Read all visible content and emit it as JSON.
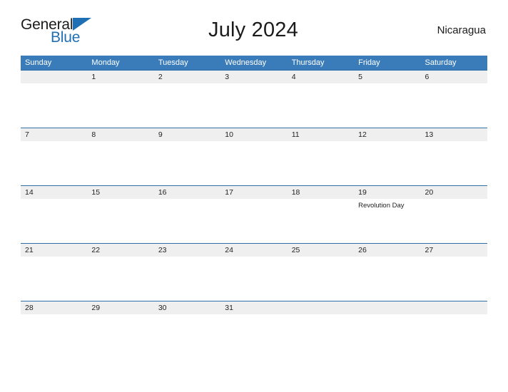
{
  "brand": {
    "name_part1": "General",
    "name_part2": "Blue",
    "flag_icon": "blue-triangle-flag-icon",
    "colors": {
      "general_text": "#1b1b1b",
      "blue_text": "#1f6fb5",
      "flag": "#1f6fb5"
    }
  },
  "header": {
    "title": "July 2024",
    "country": "Nicaragua"
  },
  "colors": {
    "header_bar": "#3a7cb9",
    "row_border": "#2f6fa8",
    "date_band": "#efefef",
    "page_background": "#ffffff",
    "text": "#222222"
  },
  "calendar": {
    "month": "July",
    "year": "2024",
    "weekday_headers": [
      "Sunday",
      "Monday",
      "Tuesday",
      "Wednesday",
      "Thursday",
      "Friday",
      "Saturday"
    ],
    "weeks": [
      {
        "days": [
          {
            "date": "",
            "events": []
          },
          {
            "date": "1",
            "events": []
          },
          {
            "date": "2",
            "events": []
          },
          {
            "date": "3",
            "events": []
          },
          {
            "date": "4",
            "events": []
          },
          {
            "date": "5",
            "events": []
          },
          {
            "date": "6",
            "events": []
          }
        ]
      },
      {
        "days": [
          {
            "date": "7",
            "events": []
          },
          {
            "date": "8",
            "events": []
          },
          {
            "date": "9",
            "events": []
          },
          {
            "date": "10",
            "events": []
          },
          {
            "date": "11",
            "events": []
          },
          {
            "date": "12",
            "events": []
          },
          {
            "date": "13",
            "events": []
          }
        ]
      },
      {
        "days": [
          {
            "date": "14",
            "events": []
          },
          {
            "date": "15",
            "events": []
          },
          {
            "date": "16",
            "events": []
          },
          {
            "date": "17",
            "events": []
          },
          {
            "date": "18",
            "events": []
          },
          {
            "date": "19",
            "events": [
              "Revolution Day"
            ]
          },
          {
            "date": "20",
            "events": []
          }
        ]
      },
      {
        "days": [
          {
            "date": "21",
            "events": []
          },
          {
            "date": "22",
            "events": []
          },
          {
            "date": "23",
            "events": []
          },
          {
            "date": "24",
            "events": []
          },
          {
            "date": "25",
            "events": []
          },
          {
            "date": "26",
            "events": []
          },
          {
            "date": "27",
            "events": []
          }
        ]
      },
      {
        "days": [
          {
            "date": "28",
            "events": []
          },
          {
            "date": "29",
            "events": []
          },
          {
            "date": "30",
            "events": []
          },
          {
            "date": "31",
            "events": []
          },
          {
            "date": "",
            "events": []
          },
          {
            "date": "",
            "events": []
          },
          {
            "date": "",
            "events": []
          }
        ]
      }
    ]
  }
}
